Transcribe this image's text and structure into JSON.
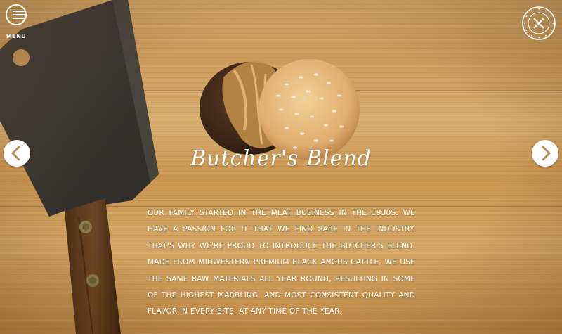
{
  "nav": {
    "menu_label": "MENU"
  },
  "logo": {
    "text": "CENTRAL & BUTCHER · FOR ONE BEST BURGERS",
    "icon": "crossed-knife-fork-seal"
  },
  "carousel": {
    "prev_icon": "chevron-left-icon",
    "next_icon": "chevron-right-icon"
  },
  "feature": {
    "title": "Butcher's Blend",
    "description": "Our family started in the meat business in the 1930s. We have a passion for it that we find rare in the industry. That's why we're proud to introduce the Butcher's Blend. Made from Midwestern premium Black Angus cattle, we use the same raw materials all year round, resulting in some of the highest marbling, and most consistent quality and flavor in every bite, at any time of the year."
  },
  "colors": {
    "text": "#ffffff",
    "wood": "#d0a062",
    "arrow_bg": "#ffffff",
    "arrow_icon": "#b88a50"
  }
}
